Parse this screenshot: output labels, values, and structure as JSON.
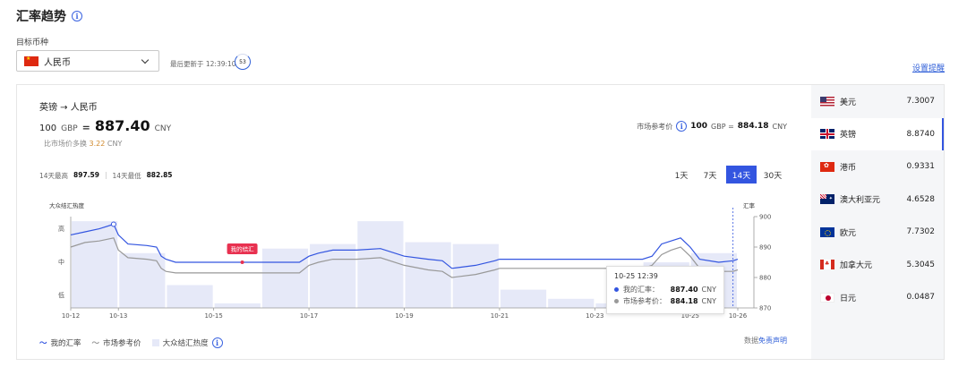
{
  "header": {
    "title": "汇率趋势",
    "info_icon": "info-icon"
  },
  "target": {
    "label": "目标币种",
    "selected": "人民币",
    "updated_text": "最后更新于 12:39:10",
    "countdown": "53"
  },
  "set_alert": "设置提醒",
  "summary": {
    "pair": "英镑 → 人民币",
    "amount": "100",
    "from_code": "GBP",
    "equals": "=",
    "value": "887.40",
    "to_code": "CNY",
    "diff_prefix": "比市场价多换",
    "diff_value": "3.22",
    "diff_unit": "CNY",
    "market_label": "市场参考价",
    "market_amount": "100",
    "market_text": "GBP = ",
    "market_value": "884.18",
    "market_code": "CNY",
    "high_label": "14天最高",
    "high_value": "897.59",
    "sep": "|",
    "low_label": "14天最低",
    "low_value": "882.85"
  },
  "periods": [
    {
      "label": "1天",
      "active": false
    },
    {
      "label": "7天",
      "active": false
    },
    {
      "label": "14天",
      "active": true
    },
    {
      "label": "30天",
      "active": false
    }
  ],
  "chart_data": {
    "type": "line",
    "left_axis_title": "大众结汇热度",
    "right_axis_title": "汇率",
    "left_ticks": [
      "高",
      "中",
      "低"
    ],
    "right_ticks": [
      900,
      890,
      880,
      870
    ],
    "ylim": [
      870,
      900
    ],
    "x_ticks": [
      "10-12",
      "10-13",
      "10-15",
      "10-17",
      "10-19",
      "10-21",
      "10-23",
      "10-25",
      "10-26"
    ],
    "x_range": [
      0,
      14
    ],
    "heat_bars": [
      {
        "start": 0,
        "end": 1,
        "level": 0.95
      },
      {
        "start": 1,
        "end": 2,
        "level": 0.6
      },
      {
        "start": 2,
        "end": 3,
        "level": 0.25
      },
      {
        "start": 3,
        "end": 4,
        "level": 0.05
      },
      {
        "start": 4,
        "end": 5,
        "level": 0.65
      },
      {
        "start": 5,
        "end": 6,
        "level": 0.7
      },
      {
        "start": 6,
        "end": 7,
        "level": 0.95
      },
      {
        "start": 7,
        "end": 8,
        "level": 0.72
      },
      {
        "start": 8,
        "end": 9,
        "level": 0.7
      },
      {
        "start": 9,
        "end": 10,
        "level": 0.2
      },
      {
        "start": 10,
        "end": 11,
        "level": 0.1
      },
      {
        "start": 11,
        "end": 12,
        "level": 0.05
      },
      {
        "start": 12,
        "end": 13,
        "level": 0.5
      },
      {
        "start": 13,
        "end": 14,
        "level": 0.6
      }
    ],
    "series": [
      {
        "name": "我的汇率",
        "color": "#3355e0",
        "x": [
          0,
          0.3,
          0.6,
          0.9,
          1.0,
          1.2,
          1.6,
          1.8,
          1.9,
          2.0,
          2.2,
          2.6,
          3,
          3.5,
          4,
          4.5,
          4.8,
          5,
          5.2,
          5.5,
          6,
          6.5,
          7,
          7.5,
          7.8,
          8,
          8.5,
          8.9,
          9,
          9.5,
          10,
          10.5,
          11,
          11.5,
          12,
          12.2,
          12.4,
          12.6,
          12.8,
          13,
          13.2,
          13.6,
          13.9,
          14
        ],
        "values": [
          894,
          895,
          896,
          897.5,
          894,
          891,
          890.5,
          890,
          887,
          886,
          885,
          885,
          885,
          885,
          885,
          885,
          885,
          887,
          888,
          889,
          889,
          889.5,
          887,
          886,
          885.5,
          883,
          884,
          885.5,
          886,
          886,
          886,
          886,
          886,
          886,
          886,
          887,
          891,
          892,
          893,
          890,
          886,
          885,
          885.5,
          886
        ]
      },
      {
        "name": "市场参考价",
        "color": "#999999",
        "x": [
          0,
          0.3,
          0.6,
          0.9,
          1.0,
          1.2,
          1.6,
          1.8,
          1.9,
          2.0,
          2.2,
          2.6,
          3,
          3.5,
          4,
          4.5,
          4.8,
          5,
          5.2,
          5.5,
          6,
          6.5,
          7,
          7.5,
          7.8,
          8,
          8.5,
          8.9,
          9,
          9.5,
          10,
          10.5,
          11,
          11.5,
          12,
          12.2,
          12.4,
          12.6,
          12.8,
          13,
          13.2,
          13.6,
          13.9,
          14
        ],
        "values": [
          890,
          891.5,
          892,
          893,
          889,
          886.5,
          886,
          885.5,
          883,
          882,
          881.5,
          881.5,
          881.5,
          881.5,
          881.5,
          881.5,
          881.5,
          884,
          885,
          886,
          886,
          886.5,
          884,
          882.5,
          882,
          880,
          881,
          882.5,
          883,
          883,
          883,
          883,
          883,
          883,
          883,
          884,
          887.5,
          889,
          890,
          887,
          883,
          882,
          882,
          882.5
        ]
      }
    ],
    "annotation": {
      "label": "我的结汇",
      "x": 3.6,
      "value": 885
    },
    "tooltip": {
      "date": "10-25 12:39",
      "rows": [
        {
          "name": "我的汇率：",
          "value": "887.40",
          "unit": "CNY",
          "color": "#3355e0"
        },
        {
          "name": "市场参考价：",
          "value": "884.18",
          "unit": "CNY",
          "color": "#999999"
        }
      ]
    },
    "legend": [
      "我的汇率",
      "市场参考价",
      "大众结汇热度"
    ],
    "legend_position": "bottom-left"
  },
  "disclaimer_prefix": "数据",
  "disclaimer_link": "免责声明",
  "currencies": [
    {
      "name": "美元",
      "value": "7.3007",
      "flag": "flag-us",
      "icon": "us-flag-icon",
      "active": false
    },
    {
      "name": "英镑",
      "value": "8.8740",
      "flag": "flag-gb",
      "icon": "gb-flag-icon",
      "active": true
    },
    {
      "name": "港币",
      "value": "0.9331",
      "flag": "flag-hk",
      "icon": "hk-flag-icon",
      "active": false
    },
    {
      "name": "澳大利亚元",
      "value": "4.6528",
      "flag": "flag-au",
      "icon": "au-flag-icon",
      "active": false
    },
    {
      "name": "欧元",
      "value": "7.7302",
      "flag": "flag-eu",
      "icon": "eu-flag-icon",
      "active": false
    },
    {
      "name": "加拿大元",
      "value": "5.3045",
      "flag": "flag-ca",
      "icon": "ca-flag-icon",
      "active": false
    },
    {
      "name": "日元",
      "value": "0.0487",
      "flag": "flag-jp",
      "icon": "jp-flag-icon",
      "active": false
    }
  ]
}
